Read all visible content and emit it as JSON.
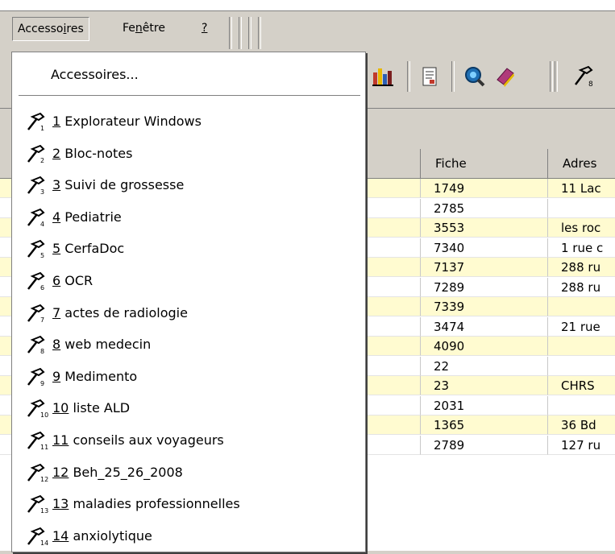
{
  "menubar": {
    "items": [
      {
        "label_pre": "Accesso",
        "label_u": "i",
        "label_post": "res"
      },
      {
        "label_pre": "Fe",
        "label_u": "n",
        "label_post": "être"
      },
      {
        "label_pre": "",
        "label_u": "?",
        "label_post": ""
      }
    ]
  },
  "toolbar": {
    "icons": [
      "bar-chart-icon",
      "document-icon",
      "magnify-globe-icon",
      "book-icon",
      "hammer-icon"
    ]
  },
  "grid": {
    "columns": [
      "Fiche",
      "Adres"
    ],
    "rows": [
      {
        "fiche": "1749",
        "adresse": "11 Lac"
      },
      {
        "fiche": "2785",
        "adresse": ""
      },
      {
        "fiche": "3553",
        "adresse": "les roc"
      },
      {
        "fiche": "7340",
        "adresse": "1 rue c"
      },
      {
        "fiche": "7137",
        "adresse": "288 ru"
      },
      {
        "fiche": "7289",
        "adresse": "288 ru"
      },
      {
        "fiche": "7339",
        "adresse": ""
      },
      {
        "fiche": "3474",
        "adresse": "21 rue"
      },
      {
        "fiche": "4090",
        "adresse": ""
      },
      {
        "fiche": "22",
        "adresse": ""
      },
      {
        "fiche": "23",
        "adresse": "CHRS"
      },
      {
        "fiche": "2031",
        "adresse": ""
      },
      {
        "fiche": "1365",
        "adresse": "36 Bd"
      },
      {
        "fiche": "2789",
        "adresse": "127 ru"
      }
    ]
  },
  "dropdown": {
    "header": "Accessoires...",
    "items": [
      {
        "num": "1",
        "label": " Explorateur Windows"
      },
      {
        "num": "2",
        "label": " Bloc-notes"
      },
      {
        "num": "3",
        "label": " Suivi de grossesse"
      },
      {
        "num": "4",
        "label": " Pediatrie"
      },
      {
        "num": "5",
        "label": " CerfaDoc"
      },
      {
        "num": "6",
        "label": " OCR"
      },
      {
        "num": "7",
        "label": " actes de radiologie"
      },
      {
        "num": "8",
        "label": " web medecin"
      },
      {
        "num": "9",
        "label": " Medimento"
      },
      {
        "num": "10",
        "label": " liste ALD"
      },
      {
        "num": "11",
        "label": " conseils aux voyageurs"
      },
      {
        "num": "12",
        "label": " Beh_25_26_2008"
      },
      {
        "num": "13",
        "label": " maladies professionnelles"
      },
      {
        "num": "14",
        "label": " anxiolytique"
      }
    ]
  },
  "colors": {
    "menu_bg": "#d4d0c8",
    "row_alt": "#fffbd0",
    "grid_bg": "#ffffff"
  }
}
